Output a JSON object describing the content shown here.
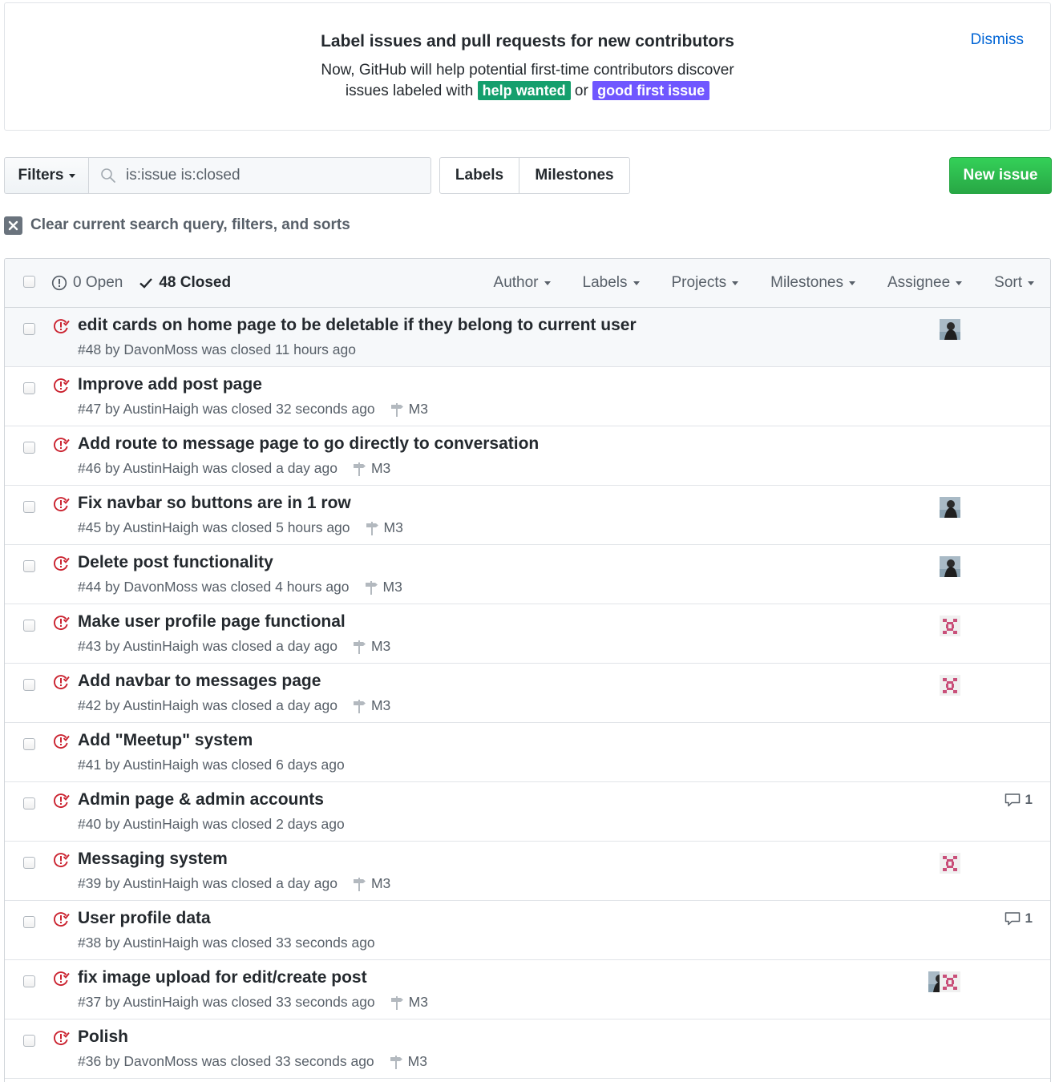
{
  "banner": {
    "title": "Label issues and pull requests for new contributors",
    "text_line1": "Now, GitHub will help potential first-time contributors discover",
    "text_line2_prefix": "issues labeled with",
    "label_help_wanted": "help wanted",
    "or_text": "or",
    "label_good_first_issue": "good first issue",
    "dismiss": "Dismiss"
  },
  "toolbar": {
    "filters_label": "Filters",
    "search_value": "is:issue is:closed",
    "labels_tab": "Labels",
    "milestones_tab": "Milestones",
    "new_issue_label": "New issue",
    "clear_text": "Clear current search query, filters, and sorts"
  },
  "header": {
    "open_count": "0 Open",
    "closed_count": "48 Closed",
    "filters": [
      "Author",
      "Labels",
      "Projects",
      "Milestones",
      "Assignee",
      "Sort"
    ]
  },
  "issues": [
    {
      "title": "edit cards on home page to be deletable if they belong to current user",
      "meta": "#48 by DavonMoss was closed 11 hours ago",
      "milestone": "",
      "assignees": [
        "dark"
      ],
      "comments": ""
    },
    {
      "title": "Improve add post page",
      "meta": "#47 by AustinHaigh was closed 32 seconds ago",
      "milestone": "M3",
      "assignees": [],
      "comments": ""
    },
    {
      "title": "Add route to message page to go directly to conversation",
      "meta": "#46 by AustinHaigh was closed a day ago",
      "milestone": "M3",
      "assignees": [],
      "comments": ""
    },
    {
      "title": "Fix navbar so buttons are in 1 row",
      "meta": "#45 by AustinHaigh was closed 5 hours ago",
      "milestone": "M3",
      "assignees": [
        "dark"
      ],
      "comments": ""
    },
    {
      "title": "Delete post functionality",
      "meta": "#44 by DavonMoss was closed 4 hours ago",
      "milestone": "M3",
      "assignees": [
        "dark"
      ],
      "comments": ""
    },
    {
      "title": "Make user profile page functional",
      "meta": "#43 by AustinHaigh was closed a day ago",
      "milestone": "M3",
      "assignees": [
        "pink"
      ],
      "comments": ""
    },
    {
      "title": "Add navbar to messages page",
      "meta": "#42 by AustinHaigh was closed a day ago",
      "milestone": "M3",
      "assignees": [
        "pink"
      ],
      "comments": ""
    },
    {
      "title": "Add \"Meetup\" system",
      "meta": "#41 by AustinHaigh was closed 6 days ago",
      "milestone": "",
      "assignees": [],
      "comments": ""
    },
    {
      "title": "Admin page & admin accounts",
      "meta": "#40 by AustinHaigh was closed 2 days ago",
      "milestone": "",
      "assignees": [],
      "comments": "1"
    },
    {
      "title": "Messaging system",
      "meta": "#39 by AustinHaigh was closed a day ago",
      "milestone": "M3",
      "assignees": [
        "pink"
      ],
      "comments": ""
    },
    {
      "title": "User profile data",
      "meta": "#38 by AustinHaigh was closed 33 seconds ago",
      "milestone": "",
      "assignees": [],
      "comments": "1"
    },
    {
      "title": "fix image upload for edit/create post",
      "meta": "#37 by AustinHaigh was closed 33 seconds ago",
      "milestone": "M3",
      "assignees": [
        "dark",
        "pink"
      ],
      "comments": ""
    },
    {
      "title": "Polish",
      "meta": "#36 by DavonMoss was closed 33 seconds ago",
      "milestone": "M3",
      "assignees": [],
      "comments": ""
    }
  ],
  "colors": {
    "closed_icon": "#cb2431",
    "green_button": "#28a745",
    "help_wanted": "#159f6d",
    "good_first_issue": "#7057ff",
    "link": "#0366d6"
  }
}
